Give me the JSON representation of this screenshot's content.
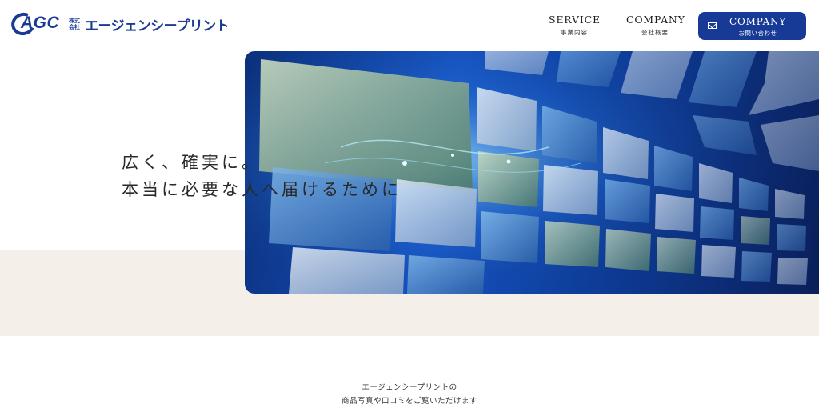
{
  "header": {
    "logo": {
      "mark_text": "AGC",
      "corp_line1": "株式",
      "corp_line2": "会社",
      "name": "エージェンシープリント"
    },
    "nav": [
      {
        "en": "SERVICE",
        "ja": "事業内容"
      },
      {
        "en": "COMPANY",
        "ja": "会社概要"
      }
    ],
    "contact": {
      "en": "COMPANY",
      "ja": "お問い合わせ",
      "icon": "mail-icon"
    }
  },
  "hero": {
    "line1": "広く、確実に。",
    "line2": "本当に必要な人へ届けるために"
  },
  "intro": {
    "line1": "エージェンシープリントの",
    "line2": "商品写真や口コミをご覧いただけます"
  },
  "colors": {
    "brand": "#163a96",
    "beige": "#f4f0e9"
  }
}
